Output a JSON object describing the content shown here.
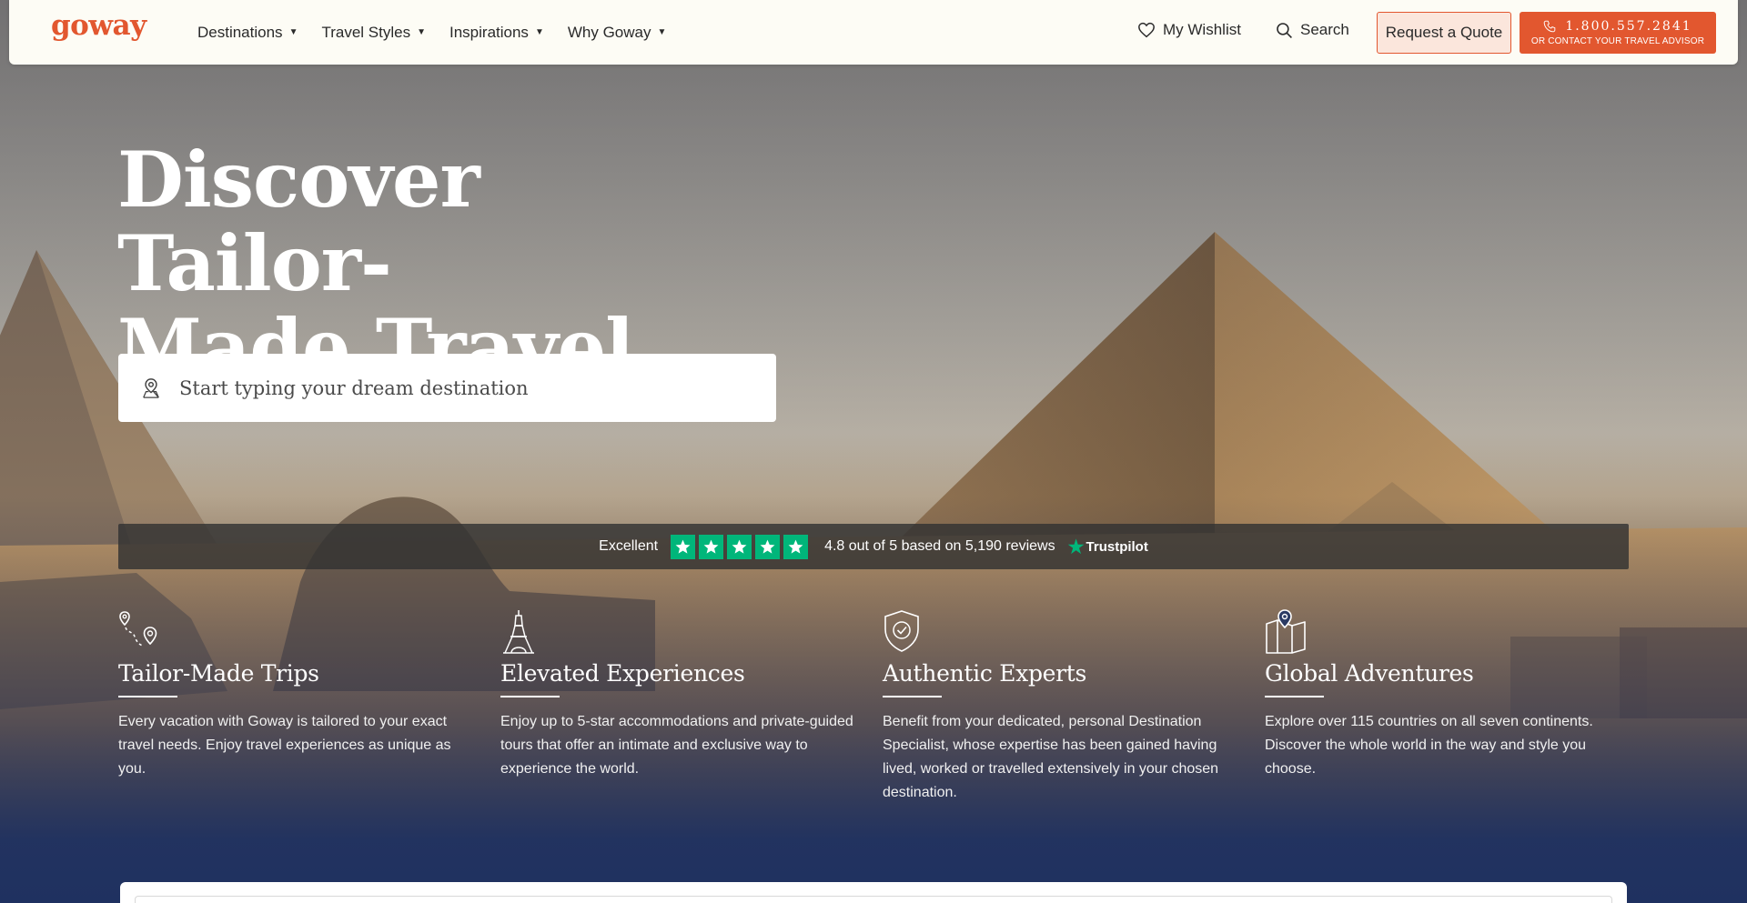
{
  "brand": {
    "logo": "goway",
    "accent": "#e2572f",
    "navy": "#1f3160",
    "trust_green": "#00b67a"
  },
  "nav": {
    "items": [
      {
        "label": "Destinations"
      },
      {
        "label": "Travel Styles"
      },
      {
        "label": "Inspirations"
      },
      {
        "label": "Why Goway"
      }
    ],
    "caret_icon": "caret-down-icon"
  },
  "header_actions": {
    "wishlist_label": "My Wishlist",
    "search_label": "Search",
    "quote_label": "Request a Quote",
    "phone_number": "1.800.557.2841",
    "phone_sub": "OR CONTACT YOUR TRAVEL ADVISOR"
  },
  "hero": {
    "title_line1": "Discover Tailor-",
    "title_line2": "Made Travel",
    "search_placeholder": "Start typing your dream destination"
  },
  "trustpilot": {
    "rating_word": "Excellent",
    "stars": 5,
    "summary": "4.8 out of 5 based on 5,190 reviews",
    "brand": "Trustpilot"
  },
  "features": [
    {
      "icon": "route-pins-icon",
      "title": "Tailor-Made Trips",
      "text": "Every vacation with Goway is tailored to your exact travel needs. Enjoy travel experiences as unique as you."
    },
    {
      "icon": "eiffel-tower-icon",
      "title": "Elevated Experiences",
      "text": "Enjoy up to 5-star accommodations and private-guided tours that offer an intimate and exclusive way to experience the world."
    },
    {
      "icon": "shield-check-icon",
      "title": "Authentic Experts",
      "text": "Benefit from your dedicated, personal Destination Specialist, whose expertise has been gained having lived, worked or travelled extensively in your chosen destination."
    },
    {
      "icon": "map-pin-icon",
      "title": "Global Adventures",
      "text": "Explore over 115 countries on all seven continents. Discover the whole world in the way and style you choose."
    }
  ]
}
